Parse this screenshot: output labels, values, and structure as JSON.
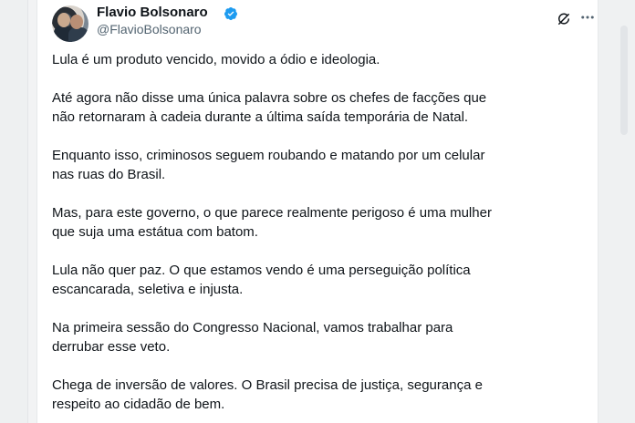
{
  "post": {
    "author_name": "Flavio Bolsonaro",
    "author_handle": "@FlavioBolsonaro",
    "paragraphs": [
      "Lula é um produto vencido, movido a ódio e ideologia.",
      "Até agora não disse uma única palavra sobre os chefes de facções que\nnão retornaram à cadeia durante a última saída temporária de Natal.",
      "Enquanto isso, criminosos seguem roubando e matando por um celular\nnas ruas do Brasil.",
      "Mas, para este governo, o que parece realmente perigoso é uma mulher\nque suja uma estátua com batom.",
      "Lula não quer paz. O que estamos vendo é uma perseguição política\nescancarada, seletiva e injusta.",
      "Na primeira sessão do Congresso Nacional, vamos trabalhar para\nderrubar esse veto.",
      "Chega de inversão de valores. O Brasil precisa de justiça, segurança e\nrespeito ao cidadão de bem."
    ]
  },
  "icons": {
    "verified": "verified-badge-icon",
    "grok": "grok-icon",
    "more": "more-options-icon"
  },
  "colors": {
    "verified_blue": "#1d9bf0",
    "text_primary": "#0f1419",
    "text_secondary": "#536471"
  }
}
